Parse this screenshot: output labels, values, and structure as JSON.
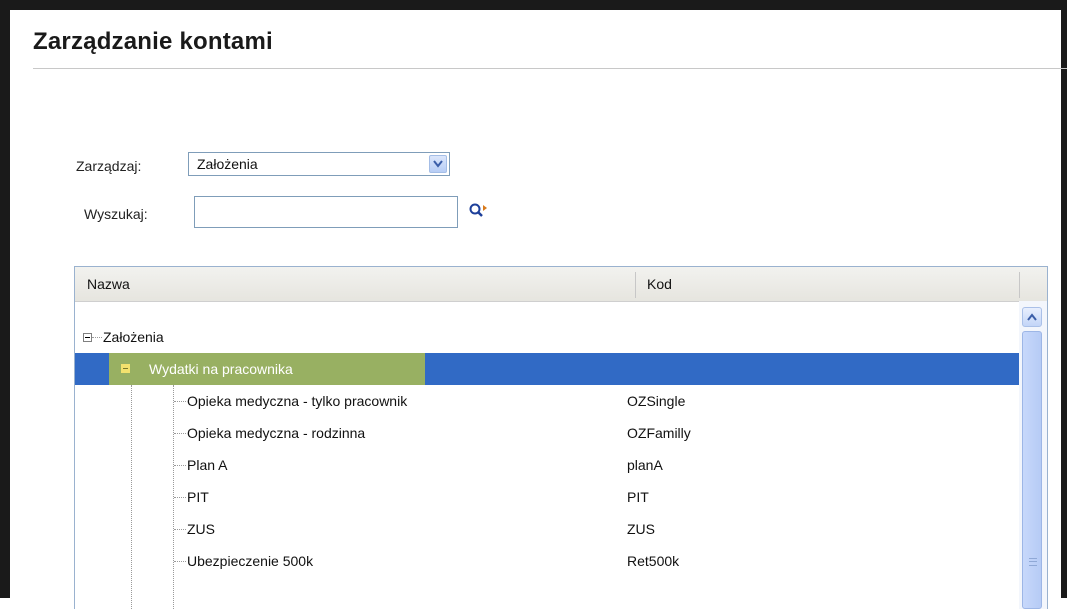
{
  "page": {
    "title": "Zarządzanie kontami"
  },
  "filters": {
    "manage_label": "Zarządzaj:",
    "manage_value": "Założenia",
    "search_label": "Wyszukaj:",
    "search_value": ""
  },
  "grid": {
    "columns": [
      "Nazwa",
      "Kod"
    ],
    "root": {
      "label": "Założenia",
      "code": ""
    },
    "group": {
      "label": "Wydatki na pracownika",
      "code": ""
    },
    "items": [
      {
        "label": "Opieka medyczna - tylko pracownik",
        "code": "OZSingle"
      },
      {
        "label": "Opieka medyczna - rodzinna",
        "code": "OZFamilly"
      },
      {
        "label": "Plan A",
        "code": "planA"
      },
      {
        "label": "PIT",
        "code": "PIT"
      },
      {
        "label": "ZUS",
        "code": "ZUS"
      },
      {
        "label": "Ubezpieczenie 500k",
        "code": "Ret500k"
      }
    ]
  },
  "colors": {
    "selection": "#316ac5",
    "highlight": "#a4b857",
    "accent_border": "#9ab2cf"
  },
  "icons": {
    "dropdown": "chevron-down-icon",
    "search": "magnifier-arrow-icon",
    "scroll_up": "chevron-up-icon"
  }
}
